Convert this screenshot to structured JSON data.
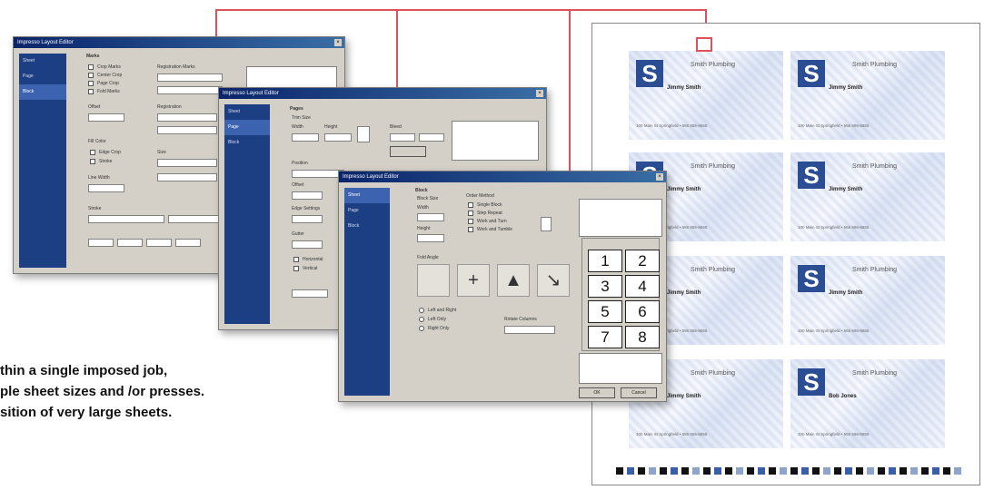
{
  "connector_color": "#e0505a",
  "windows": {
    "back": {
      "title": "Impresso Layout Editor",
      "sidebar": [
        "Sheet",
        "Page",
        "Block"
      ],
      "fields": [
        "Marks",
        "Crop Marks",
        "Center Crop",
        "Page Crop",
        "Fold Marks",
        "Registration Marks",
        "Offset",
        "Registration",
        "Fill Color",
        "Edge Crop",
        "Stroke",
        "Size",
        "Line Width",
        "Stroke"
      ]
    },
    "middle": {
      "title": "Impresso Layout Editor",
      "sidebar": [
        "Sheet",
        "Page",
        "Block"
      ],
      "fields": [
        "Pages",
        "Trim Size",
        "Width",
        "Height",
        "Bleed",
        "Position",
        "Offset",
        "Edge Settings",
        "Gutter",
        "Horizontal",
        "Vertical"
      ]
    },
    "front": {
      "title": "Impresso Layout Editor",
      "sidebar": [
        "Sheet",
        "Page",
        "Block"
      ],
      "fields": [
        "Block",
        "Block Size",
        "Width",
        "Height",
        "Order Method",
        "Single Block",
        "Step Repeat",
        "Work and Turn",
        "Work and Tumble",
        "Fold Angle",
        "Left and Right",
        "Left Only",
        "Right Only",
        "Rotate Columns"
      ],
      "grid_numbers": [
        "1",
        "2",
        "3",
        "4",
        "5",
        "6",
        "7",
        "8"
      ],
      "ok_label": "OK",
      "cancel_label": "Cancel"
    }
  },
  "caption": {
    "line1": "thin a single imposed job,",
    "line2": "ple sheet sizes and /or presses.",
    "line3": "sition of very large sheets."
  },
  "sheet": {
    "cards": [
      {
        "logo": "S",
        "company": "Smith Plumbing",
        "person": "Jimmy Smith",
        "address": "100 Main St  Springfield  •  555 555-5555"
      },
      {
        "logo": "S",
        "company": "Smith Plumbing",
        "person": "Jimmy Smith",
        "address": "100 Main St  Springfield  •  555 555-5555"
      },
      {
        "logo": "S",
        "company": "Smith Plumbing",
        "person": "Jimmy Smith",
        "address": "100 Main St  Springfield  •  555 555-5555"
      },
      {
        "logo": "S",
        "company": "Smith Plumbing",
        "person": "Jimmy Smith",
        "address": "100 Main St  Springfield  •  555 555-5555"
      },
      {
        "logo": "S",
        "company": "Smith Plumbing",
        "person": "Jimmy Smith",
        "address": "100 Main St  Springfield  •  555 555-5555"
      },
      {
        "logo": "S",
        "company": "Smith Plumbing",
        "person": "Jimmy Smith",
        "address": "100 Main St  Springfield  •  555 555-5555"
      },
      {
        "logo": "S",
        "company": "Smith Plumbing",
        "person": "Jimmy Smith",
        "address": "100 Main St  Springfield  •  555 555-5555"
      },
      {
        "logo": "S",
        "company": "Smith Plumbing",
        "person": "Bob Jones",
        "address": "100 Main St  Springfield  •  555 555-5555"
      }
    ]
  }
}
